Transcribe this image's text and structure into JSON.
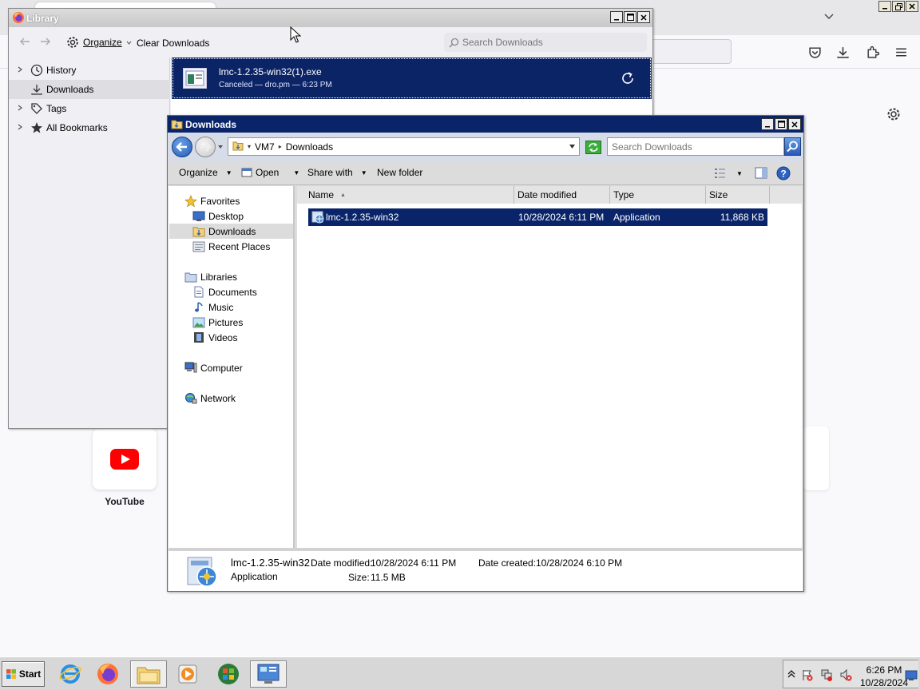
{
  "firefox": {
    "shortcut_label": "YouTube"
  },
  "library": {
    "title": "Library",
    "toolbar": {
      "organize_label": "Organize",
      "clear_label": "Clear Downloads",
      "search_placeholder": "Search Downloads"
    },
    "sidebar": [
      {
        "label": "History",
        "icon": "clock-icon",
        "expandable": true
      },
      {
        "label": "Downloads",
        "icon": "download-icon",
        "expandable": false,
        "selected": true
      },
      {
        "label": "Tags",
        "icon": "tag-icon",
        "expandable": true
      },
      {
        "label": "All Bookmarks",
        "icon": "star-icon",
        "expandable": true
      }
    ],
    "download": {
      "name": "lmc-1.2.35-win32(1).exe",
      "status": "Canceled — dro.pm — 6:23 PM"
    }
  },
  "explorer": {
    "title": "Downloads",
    "breadcrumb": [
      "VM7",
      "Downloads"
    ],
    "search_placeholder": "Search Downloads",
    "commands": {
      "organize": "Organize",
      "open": "Open",
      "share": "Share with",
      "new_folder": "New folder"
    },
    "nav": {
      "favorites": "Favorites",
      "desktop": "Desktop",
      "downloads": "Downloads",
      "recent": "Recent Places",
      "libraries": "Libraries",
      "documents": "Documents",
      "music": "Music",
      "pictures": "Pictures",
      "videos": "Videos",
      "computer": "Computer",
      "network": "Network"
    },
    "columns": {
      "name": "Name",
      "date": "Date modified",
      "type": "Type",
      "size": "Size"
    },
    "file": {
      "name": "lmc-1.2.35-win32",
      "date": "10/28/2024 6:11 PM",
      "type": "Application",
      "size": "11,868 KB"
    },
    "details": {
      "name": "lmc-1.2.35-win32",
      "type": "Application",
      "modified_label": "Date modified:",
      "modified_value": "10/28/2024 6:11 PM",
      "size_label": "Size:",
      "size_value": "11.5 MB",
      "created_label": "Date created:",
      "created_value": "10/28/2024 6:10 PM"
    }
  },
  "taskbar": {
    "start_label": "Start",
    "time": "6:26 PM",
    "date": "10/28/2024"
  },
  "colors": {
    "selection": "#0a246a",
    "youtube_red": "#ff0000"
  }
}
